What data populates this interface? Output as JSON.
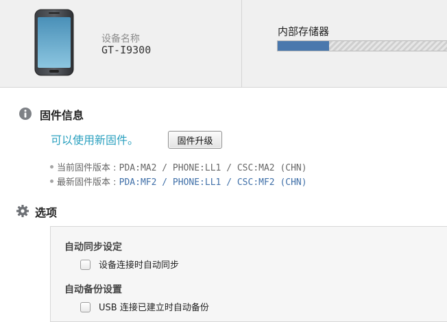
{
  "device": {
    "name_label": "设备名称",
    "model": "GT-I9300"
  },
  "storage": {
    "label": "内部存储器",
    "used_fraction": 0.29,
    "fill_color": "#4a78ad"
  },
  "firmware": {
    "icon": "info-icon",
    "title": "固件信息",
    "available_text": "可以使用新固件。",
    "upgrade_button": "固件升级",
    "current_label": "当前固件版本 : ",
    "current_value": "PDA:MA2 / PHONE:LL1 / CSC:MA2 (CHN)",
    "latest_label": "最新固件版本 : ",
    "latest_value": "PDA:MF2 / PHONE:LL1 / CSC:MF2 (CHN)"
  },
  "options": {
    "icon": "gear-icon",
    "title": "选项",
    "groups": [
      {
        "title": "自动同步设定",
        "items": [
          {
            "label": "设备连接时自动同步",
            "checked": false
          }
        ]
      },
      {
        "title": "自动备份设置",
        "items": [
          {
            "label": "USB 连接已建立时自动备份",
            "checked": false
          }
        ]
      }
    ]
  }
}
